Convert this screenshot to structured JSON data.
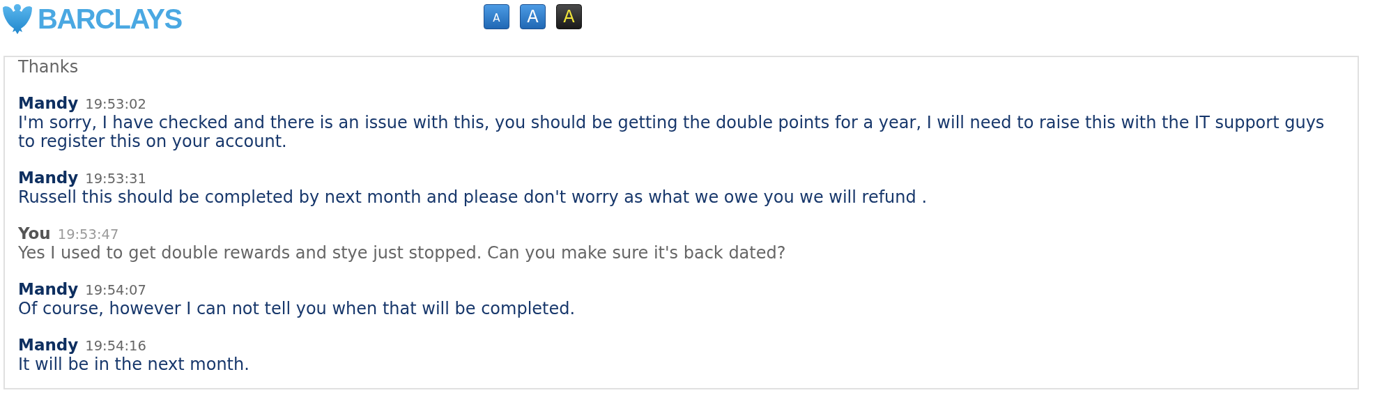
{
  "header": {
    "brand": "BARCLAYS",
    "text_size_buttons": [
      {
        "kind": "small",
        "label": "A"
      },
      {
        "kind": "large",
        "label": "A"
      },
      {
        "kind": "contrast",
        "label": "A"
      }
    ]
  },
  "transcript": {
    "messages": [
      {
        "kind": "customer",
        "text": "Thanks"
      },
      {
        "kind": "agent",
        "name": "Mandy",
        "time": "19:53:02",
        "text": "I'm sorry, I have checked and there is an issue with this, you should be getting the double points for a year, I will need to raise this with the IT support guys to register this on your account."
      },
      {
        "kind": "agent",
        "name": "Mandy",
        "time": "19:53:31",
        "text": "Russell this should be completed by next month and please don't worry as what we owe you we will refund ."
      },
      {
        "kind": "customer",
        "name": "You",
        "time": "19:53:47",
        "text": "Yes I used to get double rewards and stye just stopped. Can you make sure it's back dated?"
      },
      {
        "kind": "agent",
        "name": "Mandy",
        "time": "19:54:07",
        "text": "Of course, however I can not tell you when that will be completed."
      },
      {
        "kind": "agent",
        "name": "Mandy",
        "time": "19:54:16",
        "text": "It will be in the next month."
      }
    ]
  }
}
